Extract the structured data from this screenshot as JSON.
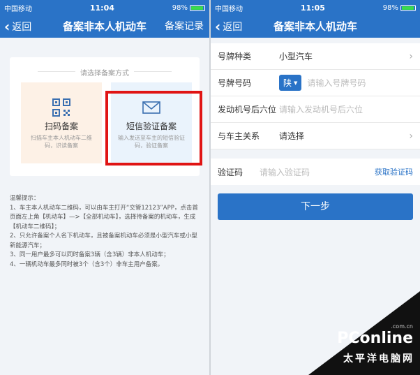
{
  "left_screen": {
    "status": {
      "carrier": "中国移动",
      "time": "11:04",
      "battery": "98%",
      "battery_level": 0.98
    },
    "nav": {
      "back": "返回",
      "title": "备案非本人机动车",
      "right_link": "备案记录"
    },
    "card": {
      "hint": "请选择备案方式",
      "options": [
        {
          "label": "扫码备案",
          "desc": "扫描车主本人机动车二维码，识读备案",
          "icon": "qr-code-icon"
        },
        {
          "label": "短信验证备案",
          "desc": "输入发送至车主的短信验证码，验证备案",
          "icon": "envelope-icon"
        }
      ]
    },
    "tips": [
      "温馨提示：",
      "1、车主本人机动车二维码，可以由车主打开“交管12123”APP，点击首页面左上角【机动车】—>【全部机动车】，选择待备案的机动车，生成【机动车二维码】；",
      "2、只允许备案个人名下机动车，且被备案机动车必须是小型汽车或小型新能源汽车；",
      "3、同一用户最多可以同时备案3辆（含3辆）非本人机动车；",
      "4、一辆机动车最多同时被3个（含3个）非车主用户备案。"
    ]
  },
  "right_screen": {
    "status": {
      "carrier": "中国移动",
      "time": "11:05",
      "battery": "98%",
      "battery_level": 0.98
    },
    "nav": {
      "back": "返回",
      "title": "备案非本人机动车"
    },
    "form": {
      "plate_type_label": "号牌种类",
      "plate_type_value": "小型汽车",
      "plate_number_label": "号牌号码",
      "province": "陕",
      "plate_number_placeholder": "请输入号牌号码",
      "engine_label": "发动机号后六位",
      "engine_placeholder": "请输入发动机号后六位",
      "relation_label": "与车主关系",
      "relation_value": "请选择"
    },
    "verify": {
      "label": "验证码",
      "placeholder": "请输入验证码",
      "get_code": "获取验证码"
    },
    "next_button": "下一步"
  },
  "watermark": {
    "brand": "PConline",
    "dotcom": ".com.cn",
    "cn": "太平洋电脑网"
  },
  "colors": {
    "primary": "#2a73c7",
    "highlight": "#e01414"
  }
}
